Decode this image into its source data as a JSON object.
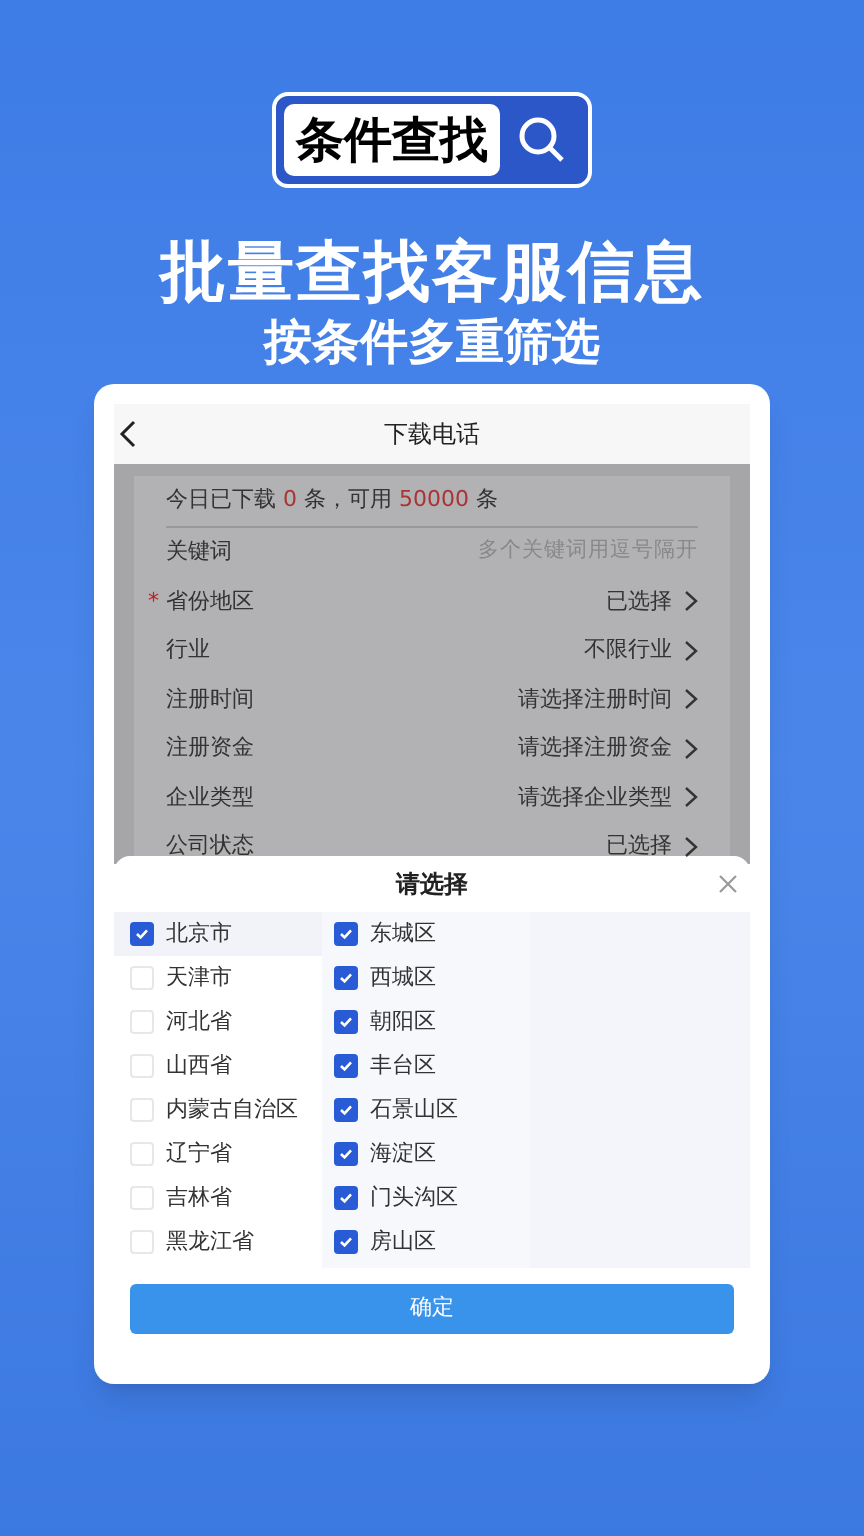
{
  "banner": {
    "badge": "条件查找",
    "headline": "批量查找客服信息",
    "subheadline": "按条件多重筛选"
  },
  "phone": {
    "title": "下载电话",
    "quota": {
      "prefix": "今日已下载",
      "downloaded": "0",
      "middle": "条，可用",
      "available": "50000",
      "suffix": "条"
    },
    "fields": [
      {
        "kind": "input",
        "label": "关键词",
        "placeholder": "多个关键词用逗号隔开"
      },
      {
        "kind": "select",
        "label": "省份地区",
        "value": "已选择",
        "required_mark": "*"
      },
      {
        "kind": "select",
        "label": "行业",
        "value": "不限行业"
      },
      {
        "kind": "select",
        "label": "注册时间",
        "value": "请选择注册时间"
      },
      {
        "kind": "select",
        "label": "注册资金",
        "value": "请选择注册资金"
      },
      {
        "kind": "select",
        "label": "企业类型",
        "value": "请选择企业类型"
      },
      {
        "kind": "select",
        "label": "公司状态",
        "value": "已选择"
      }
    ],
    "sheet": {
      "title": "请选择",
      "provinces": [
        {
          "label": "北京市",
          "checked": true,
          "selected": true
        },
        {
          "label": "天津市",
          "checked": false,
          "selected": false
        },
        {
          "label": "河北省",
          "checked": false,
          "selected": false
        },
        {
          "label": "山西省",
          "checked": false,
          "selected": false
        },
        {
          "label": "内蒙古自治区",
          "checked": false,
          "selected": false
        },
        {
          "label": "辽宁省",
          "checked": false,
          "selected": false
        },
        {
          "label": "吉林省",
          "checked": false,
          "selected": false
        },
        {
          "label": "黑龙江省",
          "checked": false,
          "selected": false
        }
      ],
      "districts": [
        {
          "label": "东城区",
          "checked": true
        },
        {
          "label": "西城区",
          "checked": true
        },
        {
          "label": "朝阳区",
          "checked": true
        },
        {
          "label": "丰台区",
          "checked": true
        },
        {
          "label": "石景山区",
          "checked": true
        },
        {
          "label": "海淀区",
          "checked": true
        },
        {
          "label": "门头沟区",
          "checked": true
        },
        {
          "label": "房山区",
          "checked": true
        }
      ],
      "confirm": "确定"
    }
  }
}
